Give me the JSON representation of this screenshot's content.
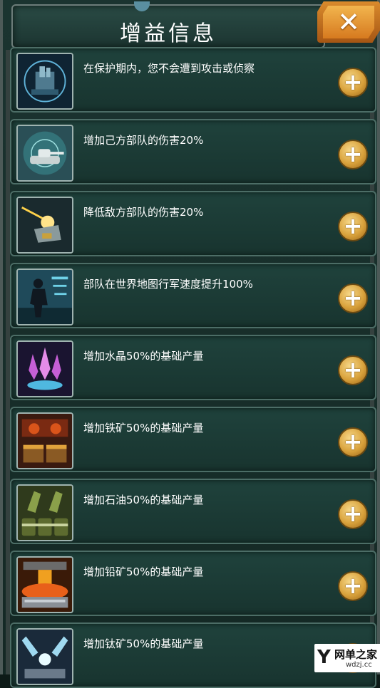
{
  "header": {
    "title": "增益信息",
    "close_label": "✕"
  },
  "buffs": [
    {
      "icon": "shield-protection-icon",
      "description": "在保护期内，您不会遭到攻击或侦察",
      "action": "+"
    },
    {
      "icon": "tank-radar-icon",
      "description": "增加己方部队的伤害20%",
      "action": "+"
    },
    {
      "icon": "laser-turret-icon",
      "description": "降低敌方部队的伤害20%",
      "action": "+"
    },
    {
      "icon": "marching-soldier-icon",
      "description": "部队在世界地图行军速度提升100%",
      "action": "+"
    },
    {
      "icon": "crystal-icon",
      "description": "增加水晶50%的基础产量",
      "action": "+"
    },
    {
      "icon": "iron-ore-icon",
      "description": "增加铁矿50%的基础产量",
      "action": "+"
    },
    {
      "icon": "oil-barrel-icon",
      "description": "增加石油50%的基础产量",
      "action": "+"
    },
    {
      "icon": "lead-ore-icon",
      "description": "增加铅矿50%的基础产量",
      "action": "+"
    },
    {
      "icon": "titanium-ore-icon",
      "description": "增加钛矿50%的基础产量",
      "action": "+"
    }
  ],
  "watermark": {
    "logo": "Y",
    "name": "网单之家",
    "url": "wdzj.cc"
  },
  "colors": {
    "panel": "#1f423c",
    "border": "#4c6d66",
    "accent": "#d9a23c",
    "close": "#e0902e"
  }
}
